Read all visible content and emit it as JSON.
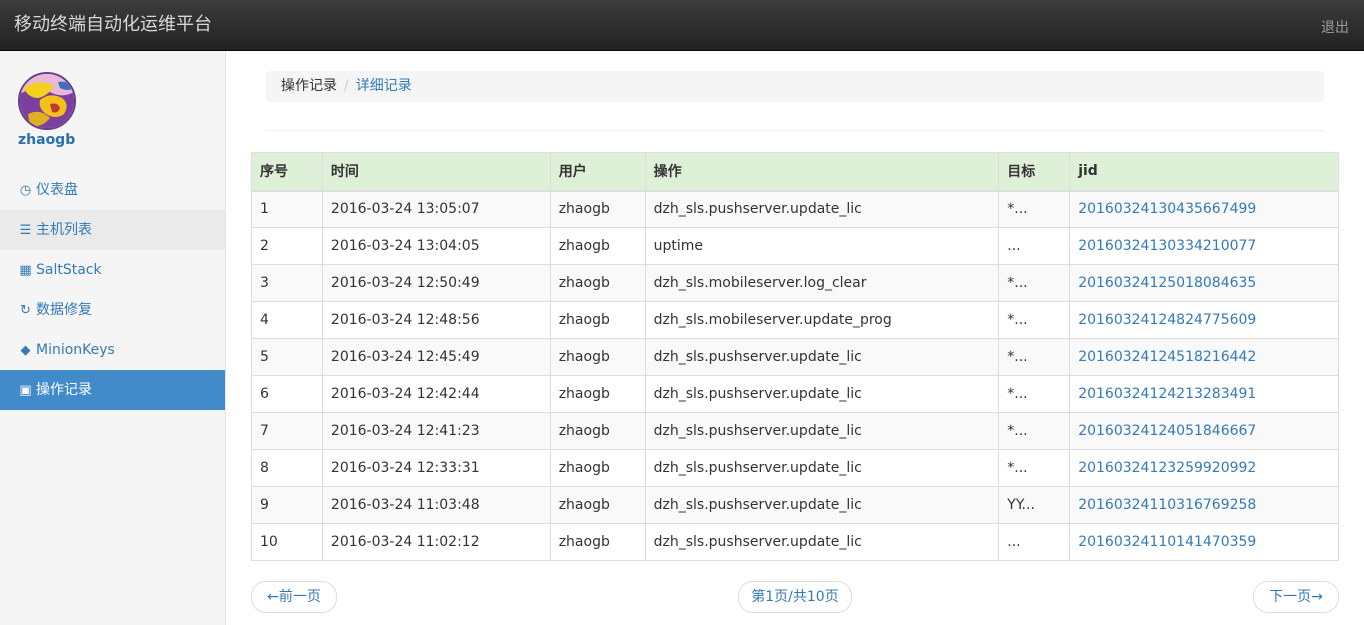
{
  "navbar": {
    "brand": "移动终端自动化运维平台",
    "logout": "退出"
  },
  "user": {
    "name": "zhaogb"
  },
  "sidebar": {
    "items": [
      {
        "label": "仪表盘",
        "icon": "dashboard-icon",
        "glyph": "◷"
      },
      {
        "label": "主机列表",
        "icon": "list-icon",
        "glyph": "☰"
      },
      {
        "label": "SaltStack",
        "icon": "grid-icon",
        "glyph": "▦"
      },
      {
        "label": "数据修复",
        "icon": "refresh-icon",
        "glyph": "↻"
      },
      {
        "label": "MinionKeys",
        "icon": "tags-icon",
        "glyph": "◆"
      },
      {
        "label": "操作记录",
        "icon": "save-icon",
        "glyph": "▣"
      }
    ]
  },
  "breadcrumb": {
    "parent": "操作记录",
    "separator": "/",
    "current": "详细记录"
  },
  "table": {
    "headers": [
      "序号",
      "时间",
      "用户",
      "操作",
      "目标",
      "jid"
    ],
    "rows": [
      [
        "1",
        "2016-03-24 13:05:07",
        "zhaogb",
        "dzh_sls.pushserver.update_lic",
        "*...",
        "20160324130435667499"
      ],
      [
        "2",
        "2016-03-24 13:04:05",
        "zhaogb",
        "uptime",
        "...",
        "20160324130334210077"
      ],
      [
        "3",
        "2016-03-24 12:50:49",
        "zhaogb",
        "dzh_sls.mobileserver.log_clear",
        "*...",
        "20160324125018084635"
      ],
      [
        "4",
        "2016-03-24 12:48:56",
        "zhaogb",
        "dzh_sls.mobileserver.update_prog",
        "*...",
        "20160324124824775609"
      ],
      [
        "5",
        "2016-03-24 12:45:49",
        "zhaogb",
        "dzh_sls.pushserver.update_lic",
        "*...",
        "20160324124518216442"
      ],
      [
        "6",
        "2016-03-24 12:42:44",
        "zhaogb",
        "dzh_sls.pushserver.update_lic",
        "*...",
        "20160324124213283491"
      ],
      [
        "7",
        "2016-03-24 12:41:23",
        "zhaogb",
        "dzh_sls.pushserver.update_lic",
        "*...",
        "20160324124051846667"
      ],
      [
        "8",
        "2016-03-24 12:33:31",
        "zhaogb",
        "dzh_sls.pushserver.update_lic",
        "*...",
        "20160324123259920992"
      ],
      [
        "9",
        "2016-03-24 11:03:48",
        "zhaogb",
        "dzh_sls.pushserver.update_lic",
        "YY...",
        "20160324110316769258"
      ],
      [
        "10",
        "2016-03-24 11:02:12",
        "zhaogb",
        "dzh_sls.pushserver.update_lic",
        "...",
        "20160324110141470359"
      ]
    ]
  },
  "pager": {
    "prev": "←前一页",
    "info": "第1页/共10页",
    "next": "下一页→"
  }
}
